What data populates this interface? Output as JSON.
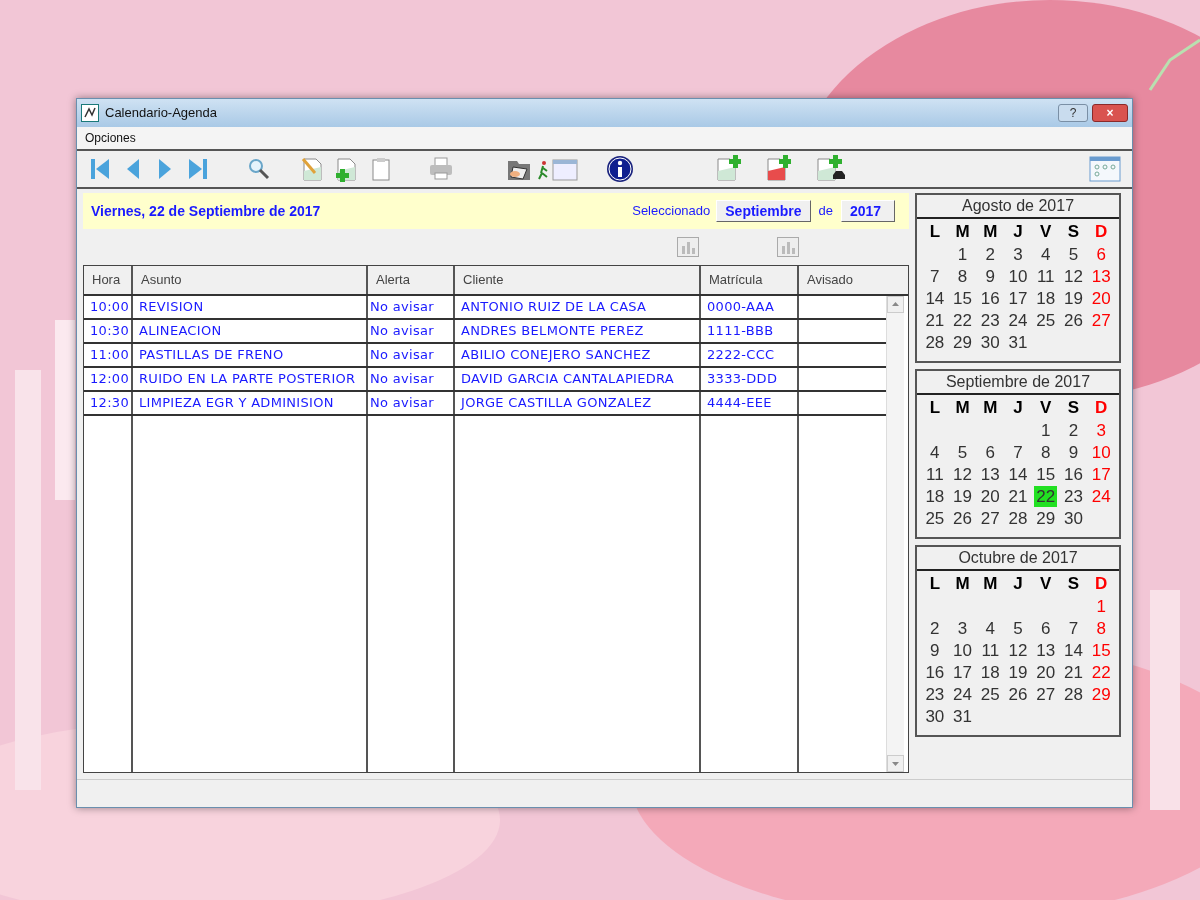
{
  "window": {
    "title": "Calendario-Agenda",
    "controls": [
      {
        "kind": "help",
        "label": "?"
      },
      {
        "kind": "close",
        "label": "×"
      }
    ]
  },
  "menu": [
    "Opciones"
  ],
  "header": {
    "date": "Viernes, 22 de Septiembre de 2017",
    "selected_label": "Seleccionado",
    "month": "Septiembre",
    "joiner": "de",
    "year": "2017"
  },
  "table": {
    "columns": [
      "Hora",
      "Asunto",
      "Alerta",
      "Cliente",
      "Matrícula",
      "Avisado"
    ],
    "rows": [
      [
        "10:00",
        "REVISION",
        "No avisar",
        "ANTONIO RUIZ DE LA CASA",
        "0000-AAA"
      ],
      [
        "10:30",
        "ALINEACION",
        "No avisar",
        "ANDRES BELMONTE PEREZ",
        "1111-BBB"
      ],
      [
        "11:00",
        "PASTILLAS DE FRENO",
        "No avisar",
        "ABILIO CONEJERO SANCHEZ",
        "2222-CCC"
      ],
      [
        "12:00",
        "RUIDO EN LA PARTE POSTERIOR",
        "No avisar",
        "DAVID GARCIA CANTALAPIEDRA",
        "3333-DDD"
      ],
      [
        "12:30",
        "LIMPIEZA EGR Y ADMINISION",
        "No avisar",
        "JORGE CASTILLA GONZALEZ",
        "4444-EEE"
      ]
    ]
  },
  "calendars": [
    {
      "title": "Agosto de 2017",
      "weekdays": [
        {
          "label": "L",
          "color": "#000000"
        },
        {
          "label": "M",
          "color": "#000000"
        },
        {
          "label": "M",
          "color": "#000000"
        },
        {
          "label": "J",
          "color": "#000000"
        },
        {
          "label": "V",
          "color": "#000000"
        },
        {
          "label": "S",
          "color": "#000000"
        },
        {
          "label": "D",
          "color": "#ff0000"
        }
      ],
      "days": [
        {
          "kind": "blank"
        },
        {
          "kind": "day",
          "d": "1",
          "selected": false
        },
        {
          "kind": "day",
          "d": "2",
          "selected": false
        },
        {
          "kind": "day",
          "d": "3",
          "selected": false
        },
        {
          "kind": "day",
          "d": "4",
          "selected": false
        },
        {
          "kind": "day",
          "d": "5",
          "selected": false
        },
        {
          "kind": "day",
          "d": "6",
          "selected": false
        },
        {
          "kind": "day",
          "d": "7",
          "selected": false
        },
        {
          "kind": "day",
          "d": "8",
          "selected": false
        },
        {
          "kind": "day",
          "d": "9",
          "selected": false
        },
        {
          "kind": "day",
          "d": "10",
          "selected": false
        },
        {
          "kind": "day",
          "d": "11",
          "selected": false
        },
        {
          "kind": "day",
          "d": "12",
          "selected": false
        },
        {
          "kind": "day",
          "d": "13",
          "selected": false
        },
        {
          "kind": "day",
          "d": "14",
          "selected": false
        },
        {
          "kind": "day",
          "d": "15",
          "selected": false
        },
        {
          "kind": "day",
          "d": "16",
          "selected": false
        },
        {
          "kind": "day",
          "d": "17",
          "selected": false
        },
        {
          "kind": "day",
          "d": "18",
          "selected": false
        },
        {
          "kind": "day",
          "d": "19",
          "selected": false
        },
        {
          "kind": "day",
          "d": "20",
          "selected": false
        },
        {
          "kind": "day",
          "d": "21",
          "selected": false
        },
        {
          "kind": "day",
          "d": "22",
          "selected": false
        },
        {
          "kind": "day",
          "d": "23",
          "selected": false
        },
        {
          "kind": "day",
          "d": "24",
          "selected": false
        },
        {
          "kind": "day",
          "d": "25",
          "selected": false
        },
        {
          "kind": "day",
          "d": "26",
          "selected": false
        },
        {
          "kind": "day",
          "d": "27",
          "selected": false
        },
        {
          "kind": "day",
          "d": "28",
          "selected": false
        },
        {
          "kind": "day",
          "d": "29",
          "selected": false
        },
        {
          "kind": "day",
          "d": "30",
          "selected": false
        },
        {
          "kind": "day",
          "d": "31",
          "selected": false
        }
      ]
    },
    {
      "title": "Septiembre de 2017",
      "weekdays": [
        {
          "label": "L",
          "color": "#000000"
        },
        {
          "label": "M",
          "color": "#000000"
        },
        {
          "label": "M",
          "color": "#000000"
        },
        {
          "label": "J",
          "color": "#000000"
        },
        {
          "label": "V",
          "color": "#000000"
        },
        {
          "label": "S",
          "color": "#000000"
        },
        {
          "label": "D",
          "color": "#ff0000"
        }
      ],
      "days": [
        {
          "kind": "blank"
        },
        {
          "kind": "blank"
        },
        {
          "kind": "blank"
        },
        {
          "kind": "blank"
        },
        {
          "kind": "day",
          "d": "1",
          "selected": false
        },
        {
          "kind": "day",
          "d": "2",
          "selected": false
        },
        {
          "kind": "day",
          "d": "3",
          "selected": false
        },
        {
          "kind": "day",
          "d": "4",
          "selected": false
        },
        {
          "kind": "day",
          "d": "5",
          "selected": false
        },
        {
          "kind": "day",
          "d": "6",
          "selected": false
        },
        {
          "kind": "day",
          "d": "7",
          "selected": false
        },
        {
          "kind": "day",
          "d": "8",
          "selected": false
        },
        {
          "kind": "day",
          "d": "9",
          "selected": false
        },
        {
          "kind": "day",
          "d": "10",
          "selected": false
        },
        {
          "kind": "day",
          "d": "11",
          "selected": false
        },
        {
          "kind": "day",
          "d": "12",
          "selected": false
        },
        {
          "kind": "day",
          "d": "13",
          "selected": false
        },
        {
          "kind": "day",
          "d": "14",
          "selected": false
        },
        {
          "kind": "day",
          "d": "15",
          "selected": false
        },
        {
          "kind": "day",
          "d": "16",
          "selected": false
        },
        {
          "kind": "day",
          "d": "17",
          "selected": false
        },
        {
          "kind": "day",
          "d": "18",
          "selected": false
        },
        {
          "kind": "day",
          "d": "19",
          "selected": false
        },
        {
          "kind": "day",
          "d": "20",
          "selected": false
        },
        {
          "kind": "day",
          "d": "21",
          "selected": false
        },
        {
          "kind": "day",
          "d": "22",
          "selected": true
        },
        {
          "kind": "day",
          "d": "23",
          "selected": false
        },
        {
          "kind": "day",
          "d": "24",
          "selected": false
        },
        {
          "kind": "day",
          "d": "25",
          "selected": false
        },
        {
          "kind": "day",
          "d": "26",
          "selected": false
        },
        {
          "kind": "day",
          "d": "27",
          "selected": false
        },
        {
          "kind": "day",
          "d": "28",
          "selected": false
        },
        {
          "kind": "day",
          "d": "29",
          "selected": false
        },
        {
          "kind": "day",
          "d": "30",
          "selected": false
        }
      ]
    },
    {
      "title": "Octubre de 2017",
      "weekdays": [
        {
          "label": "L",
          "color": "#000000"
        },
        {
          "label": "M",
          "color": "#000000"
        },
        {
          "label": "M",
          "color": "#000000"
        },
        {
          "label": "J",
          "color": "#000000"
        },
        {
          "label": "V",
          "color": "#000000"
        },
        {
          "label": "S",
          "color": "#000000"
        },
        {
          "label": "D",
          "color": "#ff0000"
        }
      ],
      "days": [
        {
          "kind": "blank"
        },
        {
          "kind": "blank"
        },
        {
          "kind": "blank"
        },
        {
          "kind": "blank"
        },
        {
          "kind": "blank"
        },
        {
          "kind": "blank"
        },
        {
          "kind": "day",
          "d": "1",
          "selected": false
        },
        {
          "kind": "day",
          "d": "2",
          "selected": false
        },
        {
          "kind": "day",
          "d": "3",
          "selected": false
        },
        {
          "kind": "day",
          "d": "4",
          "selected": false
        },
        {
          "kind": "day",
          "d": "5",
          "selected": false
        },
        {
          "kind": "day",
          "d": "6",
          "selected": false
        },
        {
          "kind": "day",
          "d": "7",
          "selected": false
        },
        {
          "kind": "day",
          "d": "8",
          "selected": false
        },
        {
          "kind": "day",
          "d": "9",
          "selected": false
        },
        {
          "kind": "day",
          "d": "10",
          "selected": false
        },
        {
          "kind": "day",
          "d": "11",
          "selected": false
        },
        {
          "kind": "day",
          "d": "12",
          "selected": false
        },
        {
          "kind": "day",
          "d": "13",
          "selected": false
        },
        {
          "kind": "day",
          "d": "14",
          "selected": false
        },
        {
          "kind": "day",
          "d": "15",
          "selected": false
        },
        {
          "kind": "day",
          "d": "16",
          "selected": false
        },
        {
          "kind": "day",
          "d": "17",
          "selected": false
        },
        {
          "kind": "day",
          "d": "18",
          "selected": false
        },
        {
          "kind": "day",
          "d": "19",
          "selected": false
        },
        {
          "kind": "day",
          "d": "20",
          "selected": false
        },
        {
          "kind": "day",
          "d": "21",
          "selected": false
        },
        {
          "kind": "day",
          "d": "22",
          "selected": false
        },
        {
          "kind": "day",
          "d": "23",
          "selected": false
        },
        {
          "kind": "day",
          "d": "24",
          "selected": false
        },
        {
          "kind": "day",
          "d": "25",
          "selected": false
        },
        {
          "kind": "day",
          "d": "26",
          "selected": false
        },
        {
          "kind": "day",
          "d": "27",
          "selected": false
        },
        {
          "kind": "day",
          "d": "28",
          "selected": false
        },
        {
          "kind": "day",
          "d": "29",
          "selected": false
        },
        {
          "kind": "day",
          "d": "30",
          "selected": false
        },
        {
          "kind": "day",
          "d": "31",
          "selected": false
        }
      ]
    }
  ]
}
